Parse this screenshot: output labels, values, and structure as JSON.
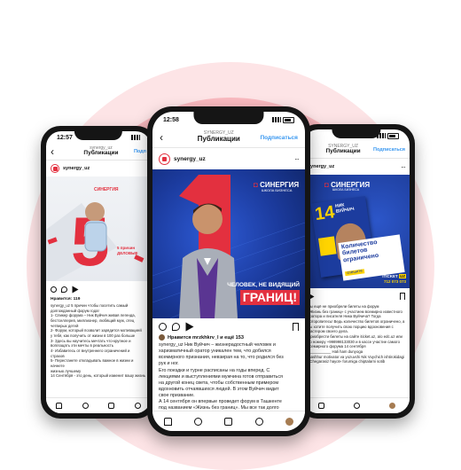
{
  "colors": {
    "brand_red": "#e3303f",
    "link_blue": "#3897f0",
    "poster_blue": "#1c3c9e"
  },
  "left_phone": {
    "time": "12:57",
    "username_small": "synergy_uz",
    "title": "Публикации",
    "subscribe": "Подп",
    "post_user": "synergy_uz",
    "brand": "СИНЕРГИЯ",
    "number": "5",
    "overlay_line1": "5 причин",
    "overlay_line2": "ДЕЛОВЫЕ",
    "likes": "Нравится: 119",
    "caption": [
      "synergy_uz 5 причин чтобы посетить самый",
      "долгожданный форум года!",
      "1- Спикер форума – Ник Вуйчич живая легенда,",
      "бестселлерев, миллионер, любящий муж, отец",
      "четверых детей",
      "2- Форум, который позволит зарядится мотивацией",
      "у тебя, как получить от жизни в 100 раз больше",
      "3- Здесь вы научитесь мечтать что-крупное и",
      "воплощать эти мечты в реальность",
      "4- Избавитесь от внутреннего ограничений и",
      "страхов",
      "5- Перестанете откладывать важное в жизни и начнете",
      "жизнью лучшему",
      "14 Сентября - это день, который изменит вашу жизнь"
    ]
  },
  "center_phone": {
    "time": "12:58",
    "username_small": "SYNERGY_UZ",
    "title": "Публикации",
    "subscribe": "Подписаться",
    "post_user": "synergy_uz",
    "brand_line1": "СИНЕРГИЯ",
    "brand_line2": "ШКОЛА БИЗНЕСА",
    "headline1": "ЧЕЛОВЕК, НЕ ВИДЯЩИЙ",
    "headline2": "ГРАНИЦ!",
    "likes": "Нравится mrzkhkrv_l и ещё 153",
    "caption": [
      "synergy_uz Ник Вуйчич – жизнерадостный человек и",
      "харизматичный оратор уникален тем, что добился",
      "всемирного признания, невзирая на то, что родился без",
      "рук и ног.",
      "Его поездки и турне расписаны на годы вперед. С",
      "лекциями и выступлениями мужчина готов отправиться",
      "на другой конец света, чтобы собственным примером",
      "вдохновить отчаявшихся людей. В этом Вуйчич видит",
      "свое призвание.",
      "А 14 сентября он впервые проведет форум в Ташкенте",
      "под названием «Жизнь без границ». Мы все так долго"
    ]
  },
  "right_phone": {
    "time": "",
    "username_small": "SYNERGY_UZ",
    "title": "Публикации",
    "subscribe": "Подписаться",
    "post_user": "synergy_uz",
    "brand_line1": "СИНЕРГИЯ",
    "brand_line2": "ШКОЛА БИЗНЕСА",
    "poster_day": "14",
    "poster_name1": "НИК",
    "poster_name2": "ВУЙЧИЧ",
    "poster_banner1": "Количество",
    "poster_banner2": "билетов",
    "poster_banner3": "ограничено",
    "poster_banner4": "спешите",
    "ticket": "iTICKET",
    "ticket_uz": "UZ",
    "phone": "712 073 073",
    "caption": [
      "Вы ещё не приобрели билеты на форум",
      "«Жизнь без границ» с участием всемирно известного",
      "оратора и писателя Ника Вуйчича? Тогда",
      "поторопитесь! Ведь количество билетов ограничено, а",
      "вы хотите получить свою порцию вдохновения с",
      "мастером своего дела.",
      "Приобрести билеты на сайте iticket.uz, a/o edc.uz или",
      "по номеру +998998133030 и в кассе участие самого",
      "всемирного форума 14 сентября",
      "___________ Hali ham dunyoga",
      "mashhur motivator va yozuvchi Nik Vuychich ishtirokidagi",
      "«Chegarasiz hayot» forumiga chiptalarni sotib"
    ]
  }
}
